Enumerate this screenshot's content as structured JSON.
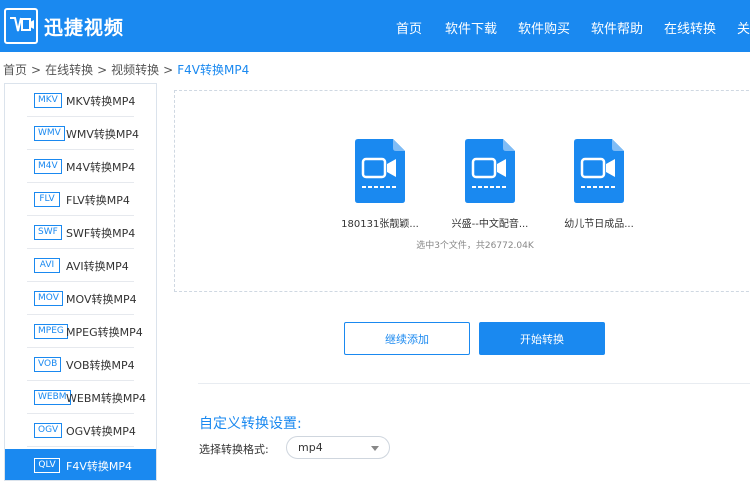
{
  "header": {
    "brand": "迅捷视频",
    "nav": [
      "首页",
      "软件下载",
      "软件购买",
      "软件帮助",
      "在线转换",
      "关"
    ]
  },
  "breadcrumb": {
    "items": [
      "首页",
      "在线转换",
      "视频转换"
    ],
    "current": "F4V转换MP4",
    "separator": ">"
  },
  "sidebar": {
    "items": [
      {
        "badge": "MKV",
        "label": "MKV转换MP4"
      },
      {
        "badge": "WMV",
        "label": "WMV转换MP4"
      },
      {
        "badge": "M4V",
        "label": "M4V转换MP4"
      },
      {
        "badge": "FLV",
        "label": "FLV转换MP4"
      },
      {
        "badge": "SWF",
        "label": "SWF转换MP4"
      },
      {
        "badge": "AVI",
        "label": "AVI转换MP4"
      },
      {
        "badge": "MOV",
        "label": "MOV转换MP4"
      },
      {
        "badge": "MPEG",
        "label": "MPEG转换MP4"
      },
      {
        "badge": "VOB",
        "label": "VOB转换MP4"
      },
      {
        "badge": "WEBM",
        "label": "WEBM转换MP4"
      },
      {
        "badge": "OGV",
        "label": "OGV转换MP4"
      },
      {
        "badge": "QLV",
        "label": "F4V转换MP4"
      }
    ],
    "active_index": 11
  },
  "files": {
    "items": [
      {
        "name": "180131张靓颖..."
      },
      {
        "name": "兴盛--中文配音..."
      },
      {
        "name": "幼儿节日成品..."
      }
    ],
    "summary": "选中3个文件，共26772.04K"
  },
  "actions": {
    "add_label": "继续添加",
    "start_label": "开始转换"
  },
  "settings": {
    "title": "自定义转换设置:",
    "format_label": "选择转换格式:",
    "format_value": "mp4"
  },
  "colors": {
    "accent": "#1a89f0"
  }
}
